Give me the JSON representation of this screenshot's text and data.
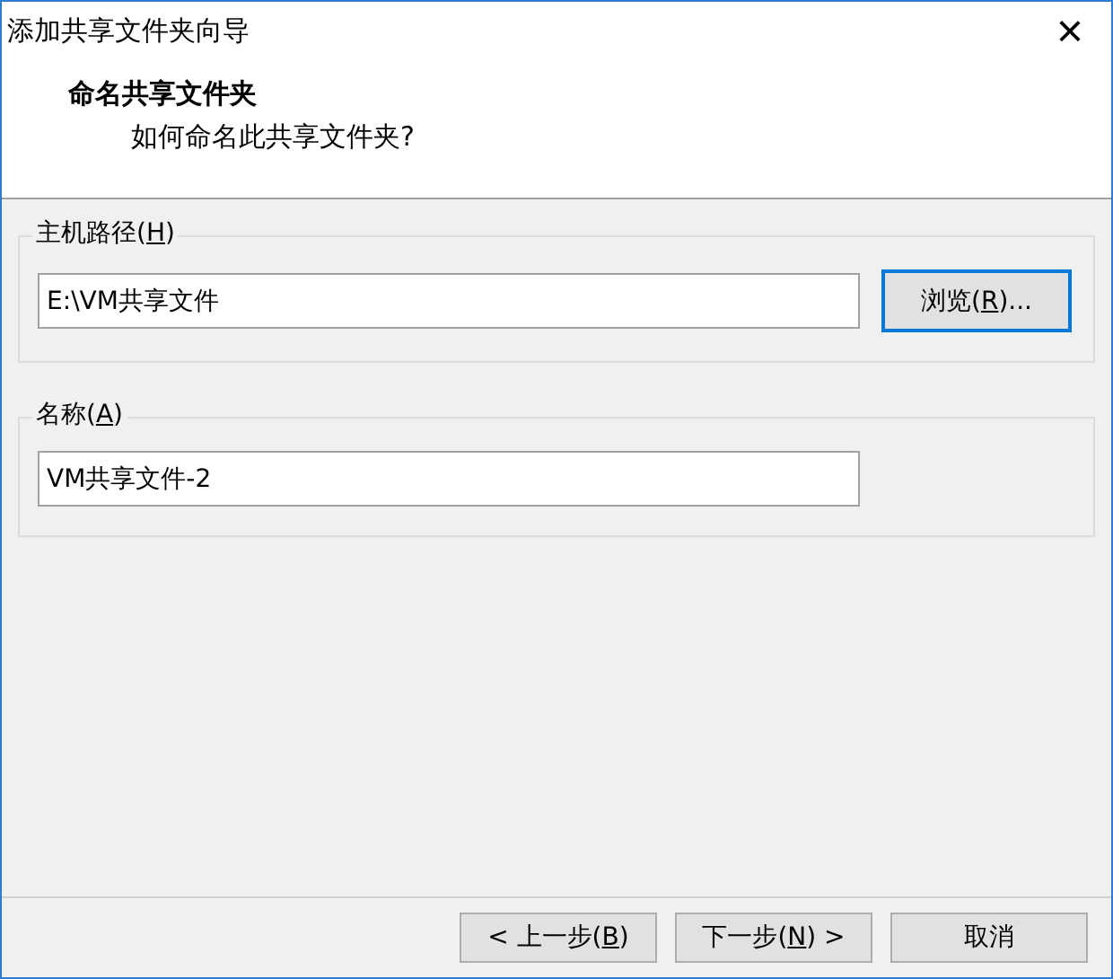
{
  "window": {
    "title": "添加共享文件夹向导",
    "close": "×"
  },
  "header": {
    "title": "命名共享文件夹",
    "subtitle": "如何命名此共享文件夹?"
  },
  "groups": [
    {
      "label": {
        "text": "主机路径(",
        "mnemonic": "H",
        "after": ")"
      },
      "value": "E:\\VM共享文件",
      "button": {
        "text": "浏览(",
        "mnemonic": "R",
        "after": ")...",
        "focused": true
      }
    },
    {
      "label": {
        "text": "名称(",
        "mnemonic": "A",
        "after": ")"
      },
      "value": "VM共享文件-2"
    }
  ],
  "buttons": [
    {
      "text": "< 上一步(",
      "mnemonic": "B",
      "after": ")"
    },
    {
      "text": "下一步(",
      "mnemonic": "N",
      "after": ") >"
    },
    {
      "text": "取消"
    }
  ]
}
